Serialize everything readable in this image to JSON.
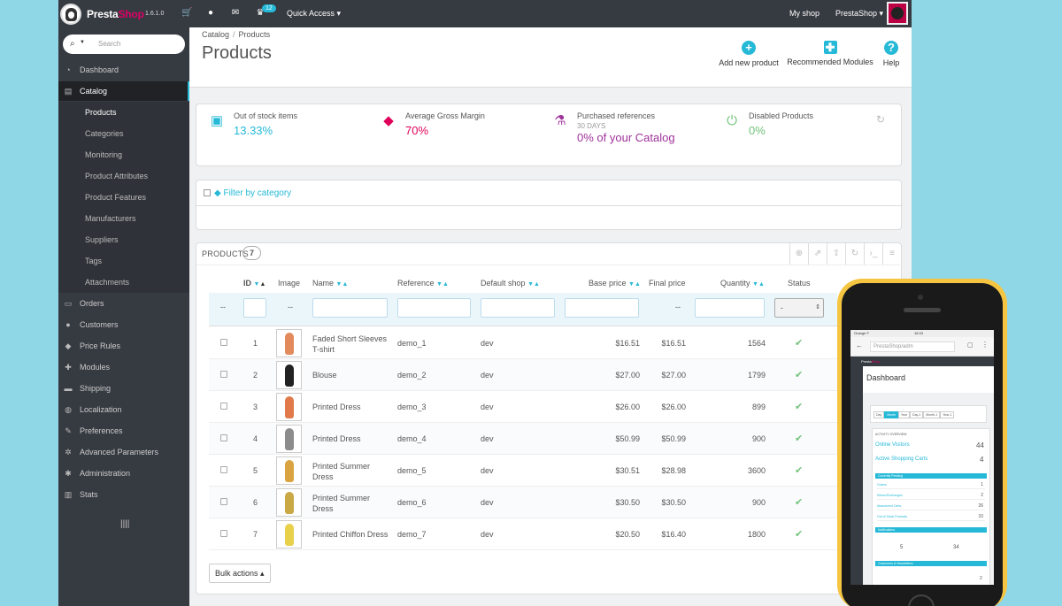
{
  "topbar": {
    "brand_part1": "Presta",
    "brand_part2": "Shop",
    "version": "1.6.1.0",
    "notifications_count": "12",
    "quick_access": "Quick Access ▾",
    "my_shop": "My shop",
    "shop_name": "PrestaShop ▾"
  },
  "sidebar": {
    "search_placeholder": "Search",
    "items": [
      {
        "label": "Dashboard",
        "icon": "dashboard-icon"
      },
      {
        "label": "Catalog",
        "icon": "book-icon"
      },
      {
        "label": "Orders",
        "icon": "credit-card-icon"
      },
      {
        "label": "Customers",
        "icon": "user-icon"
      },
      {
        "label": "Price Rules",
        "icon": "tags-icon"
      },
      {
        "label": "Modules",
        "icon": "puzzle-icon"
      },
      {
        "label": "Shipping",
        "icon": "truck-icon"
      },
      {
        "label": "Localization",
        "icon": "globe-icon"
      },
      {
        "label": "Preferences",
        "icon": "wrench-icon"
      },
      {
        "label": "Advanced Parameters",
        "icon": "cogs-icon"
      },
      {
        "label": "Administration",
        "icon": "cog-icon"
      },
      {
        "label": "Stats",
        "icon": "bar-chart-icon"
      }
    ],
    "catalog_sub": [
      "Products",
      "Categories",
      "Monitoring",
      "Product Attributes",
      "Product Features",
      "Manufacturers",
      "Suppliers",
      "Tags",
      "Attachments"
    ],
    "collapse": "||||"
  },
  "header": {
    "breadcrumb": [
      "Catalog",
      "Products"
    ],
    "breadcrumb_sep": "/",
    "title": "Products",
    "toolbar": {
      "add": "Add new product",
      "recommended": "Recommended Modules",
      "help": "Help"
    }
  },
  "kpis": [
    {
      "label": "Out of stock items",
      "value": "13.33%",
      "color": "#25b9d7"
    },
    {
      "label": "Average Gross Margin",
      "value": "70%",
      "color": "#e0005a"
    },
    {
      "label": "Purchased references",
      "sub": "30 DAYS",
      "value": "0% of your Catalog",
      "color": "#a0339c"
    },
    {
      "label": "Disabled Products",
      "value": "0%",
      "color": "#72c279"
    }
  ],
  "filter": {
    "label": "Filter by category"
  },
  "products": {
    "title": "Products",
    "count": "7",
    "columns": {
      "id": "ID",
      "image": "Image",
      "name": "Name",
      "reference": "Reference",
      "shop": "Default shop",
      "base": "Base price",
      "final": "Final price",
      "qty": "Quantity",
      "status": "Status"
    },
    "filter_dash": "--",
    "final_dash": "--",
    "status_select": "-",
    "rows": [
      {
        "id": "1",
        "name": "Faded Short Sleeves T-shirt",
        "ref": "demo_1",
        "shop": "dev",
        "base": "$16.51",
        "final": "$16.51",
        "qty": "1564",
        "dress": "#e28a5c"
      },
      {
        "id": "2",
        "name": "Blouse",
        "ref": "demo_2",
        "shop": "dev",
        "base": "$27.00",
        "final": "$27.00",
        "qty": "1799",
        "dress": "#222222"
      },
      {
        "id": "3",
        "name": "Printed Dress",
        "ref": "demo_3",
        "shop": "dev",
        "base": "$26.00",
        "final": "$26.00",
        "qty": "899",
        "dress": "#e07a4a"
      },
      {
        "id": "4",
        "name": "Printed Dress",
        "ref": "demo_4",
        "shop": "dev",
        "base": "$50.99",
        "final": "$50.99",
        "qty": "900",
        "dress": "#8c8c8c"
      },
      {
        "id": "5",
        "name": "Printed Summer Dress",
        "ref": "demo_5",
        "shop": "dev",
        "base": "$30.51",
        "final": "$28.98",
        "qty": "3600",
        "dress": "#d9a441"
      },
      {
        "id": "6",
        "name": "Printed Summer Dress",
        "ref": "demo_6",
        "shop": "dev",
        "base": "$30.50",
        "final": "$30.50",
        "qty": "900",
        "dress": "#c9a845"
      },
      {
        "id": "7",
        "name": "Printed Chiffon Dress",
        "ref": "demo_7",
        "shop": "dev",
        "base": "$20.50",
        "final": "$16.40",
        "qty": "1800",
        "dress": "#e8d04a"
      }
    ],
    "bulk": "Bulk actions ▴"
  },
  "phone": {
    "carrier": "Orange F",
    "time": "18:33",
    "url": "PrestaShop/adm",
    "page_title": "Dashboard",
    "tabs": [
      "Day",
      "Month",
      "Year",
      "Day-1",
      "Month-1",
      "Year-1"
    ],
    "activity": "ACTIVITY OVERVIEW",
    "online": "Online Visitors",
    "online_val": "44",
    "carts": "Active Shopping Carts",
    "carts_val": "4",
    "pending": "Currently Pending",
    "lines": [
      {
        "label": "Orders",
        "val": "1"
      },
      {
        "label": "Return/Exchanges",
        "val": "2"
      },
      {
        "label": "Abandoned Carts",
        "val": "26"
      },
      {
        "label": "Out of Stock Products",
        "val": "10"
      }
    ],
    "notifications": "Notifications",
    "messages_val": "5",
    "reviews_val": "34",
    "customers": "Customers & Newsletters",
    "new_customers_val": "2"
  }
}
